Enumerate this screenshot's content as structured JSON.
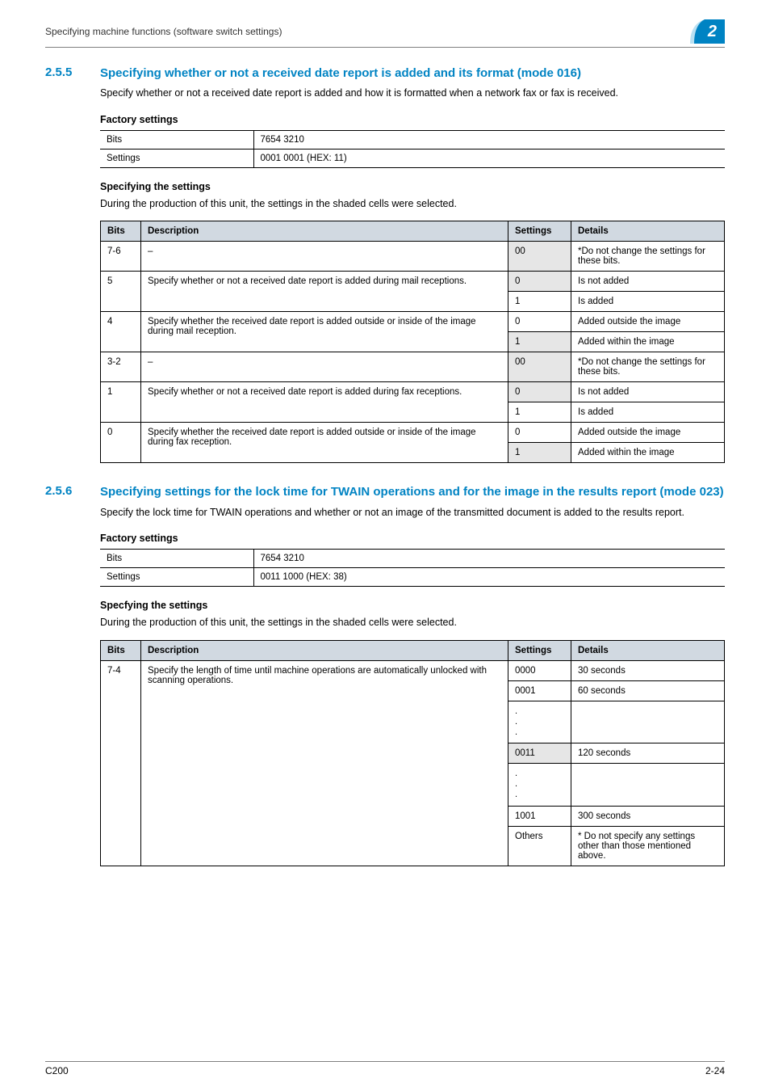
{
  "header": {
    "breadcrumb": "Specifying machine functions (software switch settings)",
    "chapter": "2"
  },
  "s255": {
    "num": "2.5.5",
    "title": "Specifying whether or not a received date report is added and its format (mode 016)",
    "intro": "Specify whether or not a received date report is added and how it is formatted when a network fax or fax is received.",
    "factory_heading": "Factory settings",
    "factory": {
      "bits_label": "Bits",
      "bits_value": "7654 3210",
      "settings_label": "Settings",
      "settings_value": "0001 0001 (HEX: 11)"
    },
    "spec_heading": "Specifying the settings",
    "spec_intro": "During the production of this unit, the settings in the shaded cells were selected.",
    "table": {
      "h_bits": "Bits",
      "h_desc": "Description",
      "h_set": "Settings",
      "h_det": "Details",
      "r0": {
        "bits": "7-6",
        "desc": "–",
        "set": "00",
        "det": "*Do not change the settings for these bits."
      },
      "r1": {
        "bits": "5",
        "desc": "Specify whether or not a received date report is added during mail receptions.",
        "set0": "0",
        "det0": "Is not added",
        "set1": "1",
        "det1": "Is added"
      },
      "r2": {
        "bits": "4",
        "desc": "Specify whether the received date report is added outside or inside of the image during mail reception.",
        "set0": "0",
        "det0": "Added outside the image",
        "set1": "1",
        "det1": "Added within the image"
      },
      "r3": {
        "bits": "3-2",
        "desc": "–",
        "set": "00",
        "det": "*Do not change the settings for these bits."
      },
      "r4": {
        "bits": "1",
        "desc": "Specify whether or not a received date report is added during fax receptions.",
        "set0": "0",
        "det0": "Is not added",
        "set1": "1",
        "det1": "Is added"
      },
      "r5": {
        "bits": "0",
        "desc": "Specify whether the received date report is added outside or inside of the image during fax reception.",
        "set0": "0",
        "det0": "Added outside the image",
        "set1": "1",
        "det1": "Added within the image"
      }
    }
  },
  "s256": {
    "num": "2.5.6",
    "title": "Specifying settings for the lock time for TWAIN operations and for the image in the results report (mode 023)",
    "intro": "Specify the lock time for TWAIN operations and whether or not an image of the transmitted document is added to the results report.",
    "factory_heading": "Factory settings",
    "factory": {
      "bits_label": "Bits",
      "bits_value": "7654 3210",
      "settings_label": "Settings",
      "settings_value": "0011 1000 (HEX: 38)"
    },
    "spec_heading": "Specfying the settings",
    "spec_intro": "During the production of this unit, the settings in the shaded cells were selected.",
    "table": {
      "h_bits": "Bits",
      "h_desc": "Description",
      "h_set": "Settings",
      "h_det": "Details",
      "bits": "7-4",
      "desc": "Specify the length of time until machine operations are automatically unlocked with scanning operations.",
      "r0": {
        "set": "0000",
        "det": "30 seconds"
      },
      "r1": {
        "set": "0001",
        "det": "60 seconds"
      },
      "r2": {
        "set": "0011",
        "det": "120 seconds"
      },
      "r3": {
        "set": "1001",
        "det": "300 seconds"
      },
      "r4": {
        "set": "Others",
        "det": "* Do not specify any settings other than those mentioned above."
      }
    }
  },
  "footer": {
    "left": "C200",
    "right": "2-24"
  }
}
